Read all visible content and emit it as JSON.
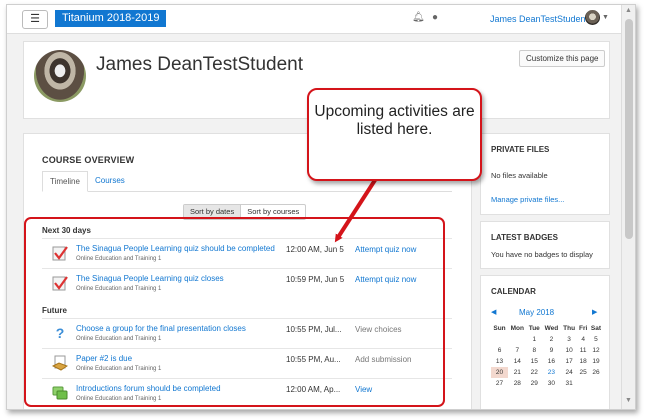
{
  "navbar": {
    "site_name": "Titanium 2018-2019",
    "user_name": "James DeanTestStudent",
    "menu_icon": "hamburger-icon",
    "notification_icon": "bell-icon",
    "messages_icon": "chat-icon"
  },
  "header": {
    "title": "James DeanTestStudent",
    "customize_label": "Customize this page"
  },
  "course_overview": {
    "title": "COURSE OVERVIEW",
    "tabs": [
      "Timeline",
      "Courses"
    ],
    "sort_buttons": [
      "Sort by dates",
      "Sort by courses"
    ],
    "sections": [
      {
        "label": "Next 30 days",
        "items": [
          {
            "icon": "quiz-icon",
            "name": "The Sinagua People Learning quiz should be completed",
            "course": "Online Education and Training 1",
            "date": "12:00 AM, Jun 5",
            "action": "Attempt quiz now"
          },
          {
            "icon": "quiz-icon",
            "name": "The Sinagua People Learning quiz closes",
            "course": "Online Education and Training 1",
            "date": "10:59 PM, Jun 5",
            "action": "Attempt quiz now"
          }
        ]
      },
      {
        "label": "Future",
        "items": [
          {
            "icon": "choice-icon",
            "name": "Choose a group for the final presentation closes",
            "course": "Online Education and Training 1",
            "date": "10:55 PM, Jul...",
            "action": "View choices"
          },
          {
            "icon": "assignment-icon",
            "name": "Paper #2 is due",
            "course": "Online Education and Training 1",
            "date": "10:55 PM, Au...",
            "action": "Add submission"
          },
          {
            "icon": "forum-icon",
            "name": "Introductions forum should be completed",
            "course": "Online Education and Training 1",
            "date": "12:00 AM, Ap...",
            "action": "View"
          }
        ]
      }
    ]
  },
  "private_files": {
    "title": "PRIVATE FILES",
    "empty_text": "No files available",
    "manage_link": "Manage private files..."
  },
  "latest_badges": {
    "title": "LATEST BADGES",
    "empty_text": "You have no badges to display"
  },
  "calendar": {
    "title": "CALENDAR",
    "month": "May 2018",
    "weekdays": [
      "Sun",
      "Mon",
      "Tue",
      "Wed",
      "Thu",
      "Fri",
      "Sat"
    ],
    "weeks": [
      [
        "",
        "",
        "1",
        "2",
        "3",
        "4",
        "5"
      ],
      [
        "6",
        "7",
        "8",
        "9",
        "10",
        "11",
        "12"
      ],
      [
        "13",
        "14",
        "15",
        "16",
        "17",
        "18",
        "19"
      ],
      [
        "20",
        "21",
        "22",
        "23",
        "24",
        "25",
        "26"
      ],
      [
        "27",
        "28",
        "29",
        "30",
        "31",
        "",
        ""
      ]
    ],
    "weekday_abbr": [
      "Sun",
      "Mon",
      "Tue",
      "Wed",
      "Thu",
      "Fri",
      "Sat"
    ]
  },
  "callout": {
    "text": "Upcoming activities are listed here."
  },
  "colors": {
    "link": "#1177d1",
    "site_badge": "#1177d1",
    "annotation_red": "#d4141a"
  }
}
